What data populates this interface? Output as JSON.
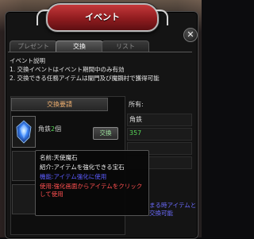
{
  "window": {
    "title": "イベント",
    "close_glyph": "✕"
  },
  "tabs": [
    {
      "label": "プレゼント",
      "active": false
    },
    {
      "label": "交換",
      "active": true
    },
    {
      "label": "リスト",
      "active": false
    }
  ],
  "description": {
    "heading": "イベント説明",
    "lines": [
      "1. 交換イベントはイベント期間中のみ有効",
      "2. 交換できる任務アイテムは闇門及び魔鋼村で獲得可能"
    ]
  },
  "exchange": {
    "header": "交換要請",
    "item": {
      "name": "角鉄",
      "qty": "2",
      "unit": "個",
      "icon": "angel-gem-icon"
    },
    "button_label": "交換"
  },
  "owned": {
    "label": "所有:",
    "item_name": "角鉄",
    "qty": "357"
  },
  "tooltip": {
    "name_line": "名前:天使魔石",
    "intro_line": "紹介:アイテムを強化できる宝石",
    "use_line": "機能:アイテム強化に使用",
    "warning": "使用:強化画面からアイテムをクリックして使用"
  },
  "behind_text": {
    "line1": "まる時アイテムと",
    "line2": "交換可能"
  },
  "colors": {
    "accent_green": "#58d858",
    "title_red": "#a02024",
    "header_orange": "#f0b070",
    "warn_red": "#ff5050"
  }
}
